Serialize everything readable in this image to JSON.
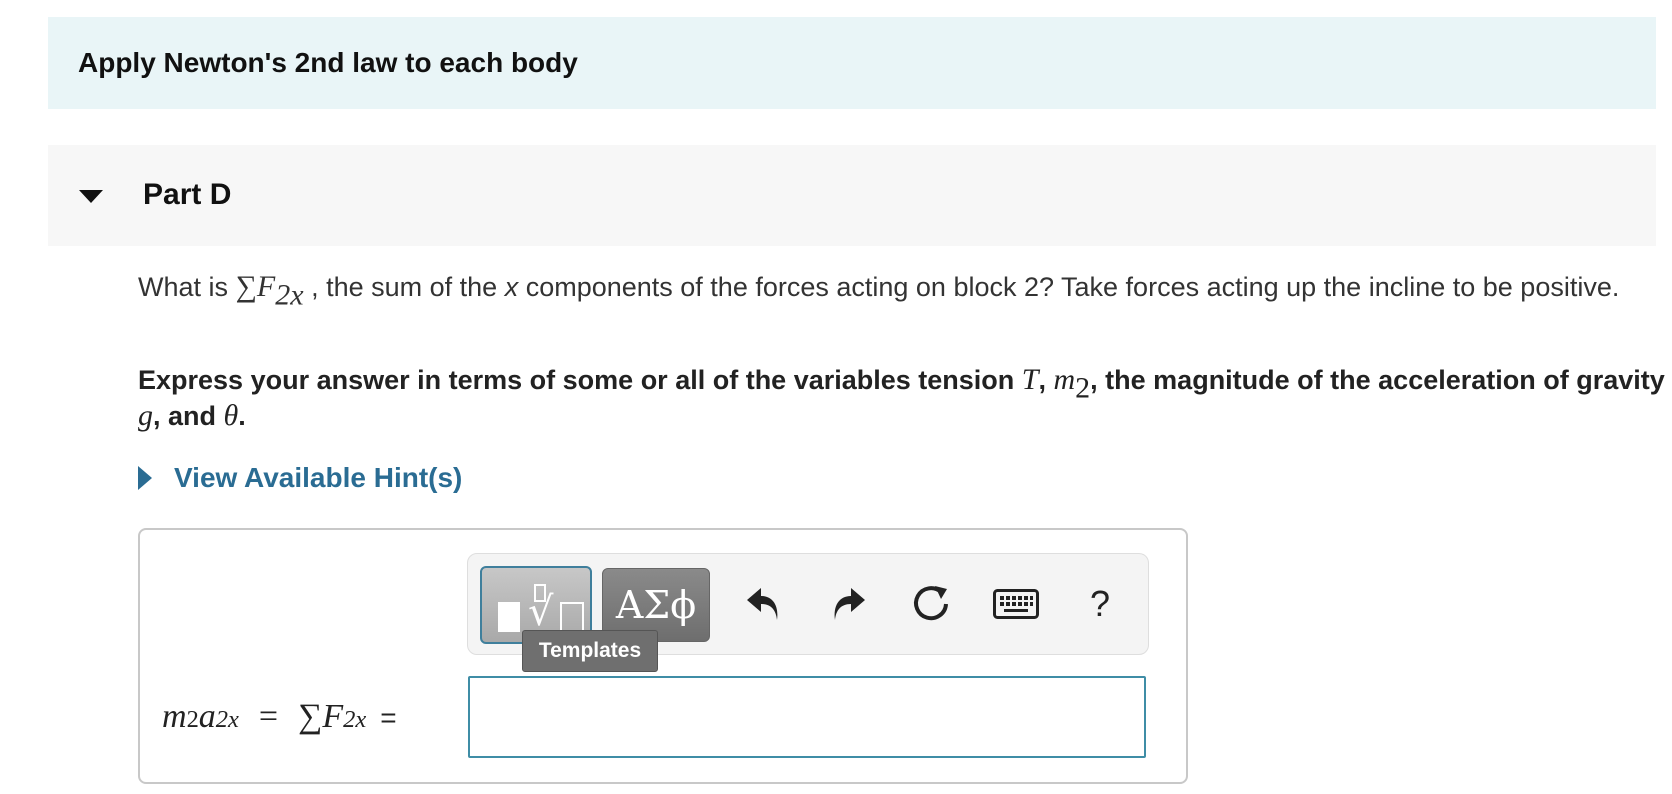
{
  "banner": {
    "title": "Apply Newton's 2nd law to each body"
  },
  "part": {
    "title": "Part D"
  },
  "question": {
    "prefix": "What is ",
    "sum_symbol": "∑",
    "var": "F",
    "sub": "2x",
    "suffix": " , the sum of the ",
    "x_word": "x",
    "suffix2": " components of the forces acting on block 2? Take forces acting up the incline to be positive."
  },
  "instruction": {
    "part1": "Express your answer in terms of some or all of the variables tension ",
    "T": "T",
    "comma1": ", ",
    "m": "m",
    "m_sub": "2",
    "part2": ", the magnitude of the acceleration of gravity ",
    "g": "g",
    "part3": ", and ",
    "theta": "θ",
    "end": "."
  },
  "hint": {
    "label": "View Available Hint(s)"
  },
  "toolbar": {
    "greek_label": "ΑΣϕ",
    "tooltip": "Templates",
    "help_label": "?",
    "icons": [
      "templates-icon",
      "greek-symbols-icon",
      "undo-icon",
      "redo-icon",
      "reset-icon",
      "keyboard-icon",
      "help-icon"
    ]
  },
  "equation": {
    "m": "m",
    "m_sub": "2",
    "a": "a",
    "a_sub": "2x",
    "equals": "=",
    "sum_symbol": "∑",
    "F": "F",
    "F_sub": "2x",
    "plain_equals": "="
  },
  "answer": {
    "value": ""
  },
  "colors": {
    "banner_bg": "#e9f5f7",
    "link": "#2a6c93",
    "input_border": "#3f8da6"
  }
}
